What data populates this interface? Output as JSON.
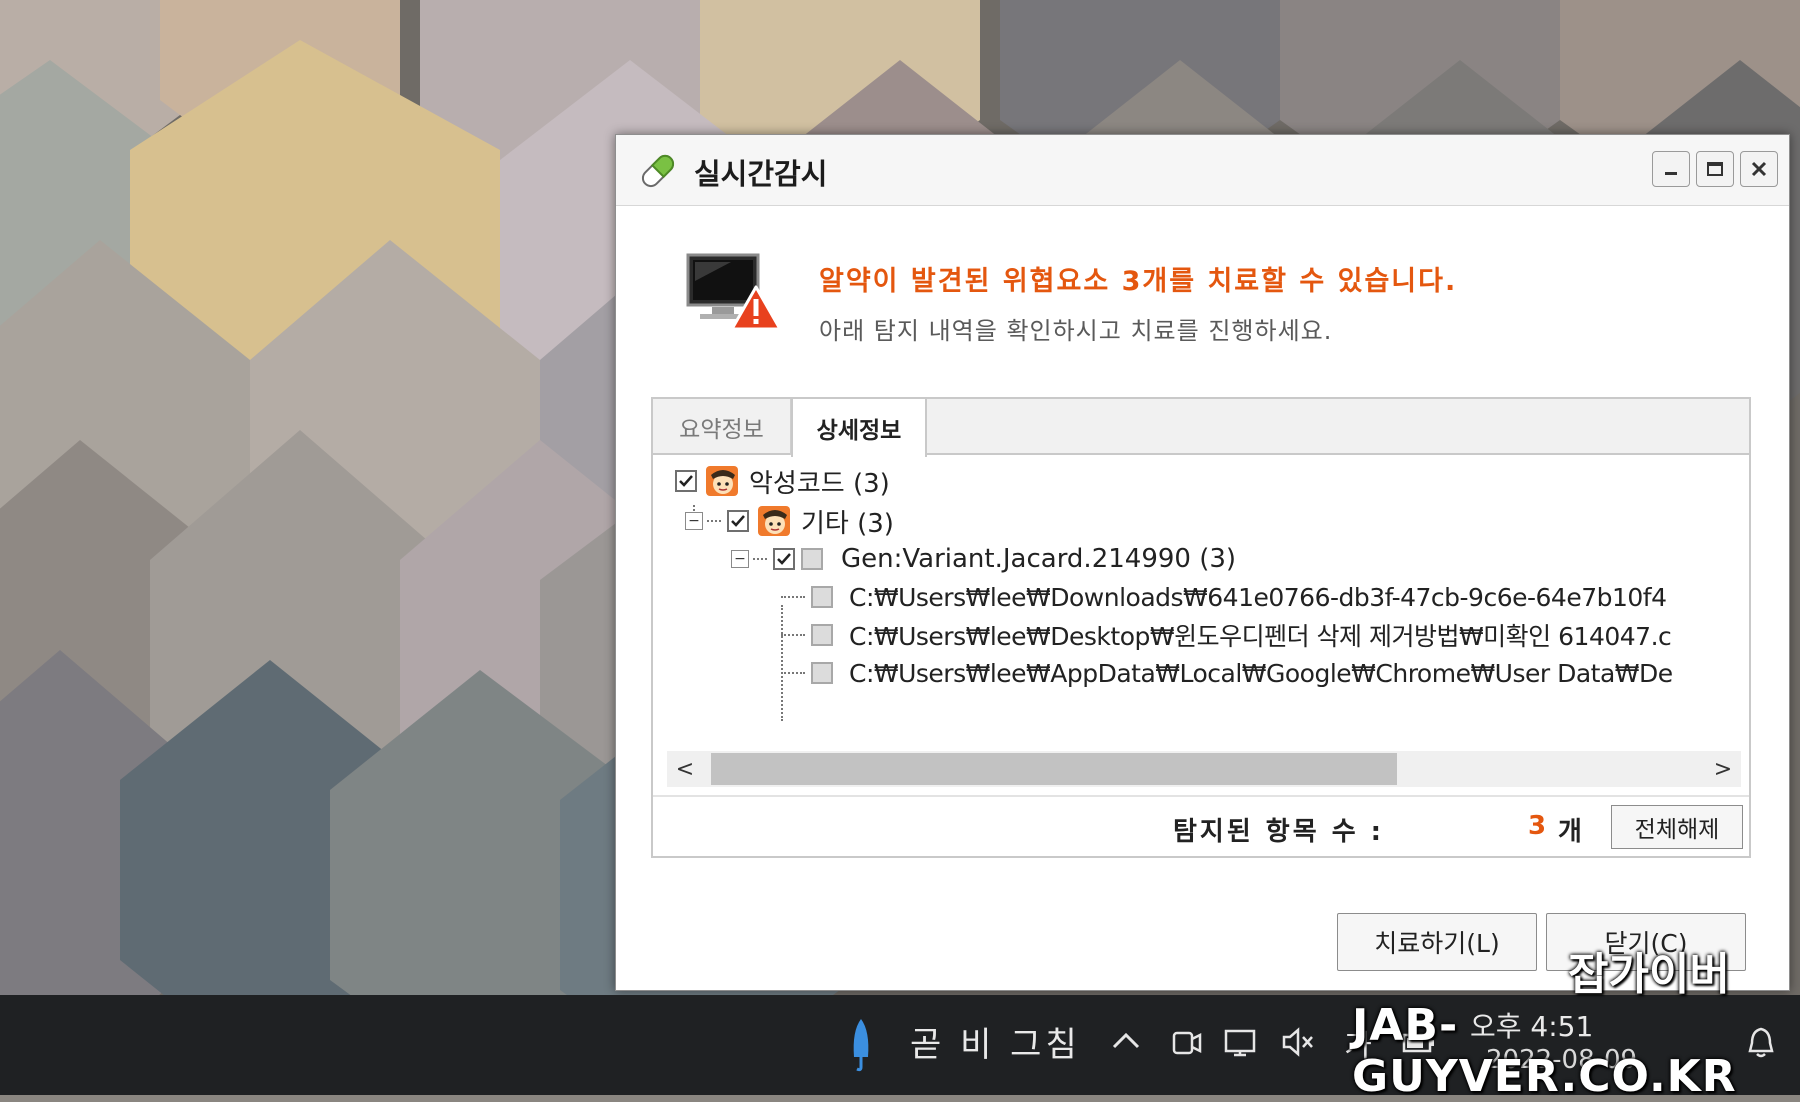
{
  "window": {
    "title": "실시간감시",
    "headline": "알약이 발견된 위협요소 3개를 치료할 수 있습니다.",
    "subline": "아래 탐지 내역을 확인하시고 치료를 진행하세요."
  },
  "tabs": [
    {
      "label": "요약정보",
      "active": false
    },
    {
      "label": "상세정보",
      "active": true
    }
  ],
  "tree": {
    "root": {
      "label": "악성코드 (3)",
      "checked": true,
      "icon": "virus-icon"
    },
    "category": {
      "label": "기타 (3)",
      "checked": true,
      "icon": "virus-icon"
    },
    "variant": {
      "label": "Gen:Variant.Jacard.214990 (3)",
      "checked": true
    },
    "files": [
      {
        "path": "C:₩Users₩lee₩Downloads₩641e0766-db3f-47cb-9c6e-64e7b10f4"
      },
      {
        "path": "C:₩Users₩lee₩Desktop₩윈도우디펜더 삭제 제거방법₩미확인 614047.c"
      },
      {
        "path": "C:₩Users₩lee₩AppData₩Local₩Google₩Chrome₩User Data₩De"
      }
    ]
  },
  "scrollbar": {
    "left_arrow": "<",
    "right_arrow": ">"
  },
  "summary": {
    "count_label": "탐지된 항목 수 :",
    "count_value": "3",
    "count_unit": "개",
    "deselect_all_label": "전체해제"
  },
  "buttons": {
    "treat_label": "치료하기(L)",
    "close_label": "닫기(C)"
  },
  "taskbar": {
    "weather_text": "곧 비 그침",
    "time": "오후 4:51",
    "date": "2022-08-09",
    "ime_label": "가"
  },
  "watermark": {
    "line1": "잡가이버",
    "line2": "JAB-GUYVER.CO.KR"
  },
  "colors": {
    "accent_orange": "#e4570f",
    "taskbar": "#1f2123"
  }
}
